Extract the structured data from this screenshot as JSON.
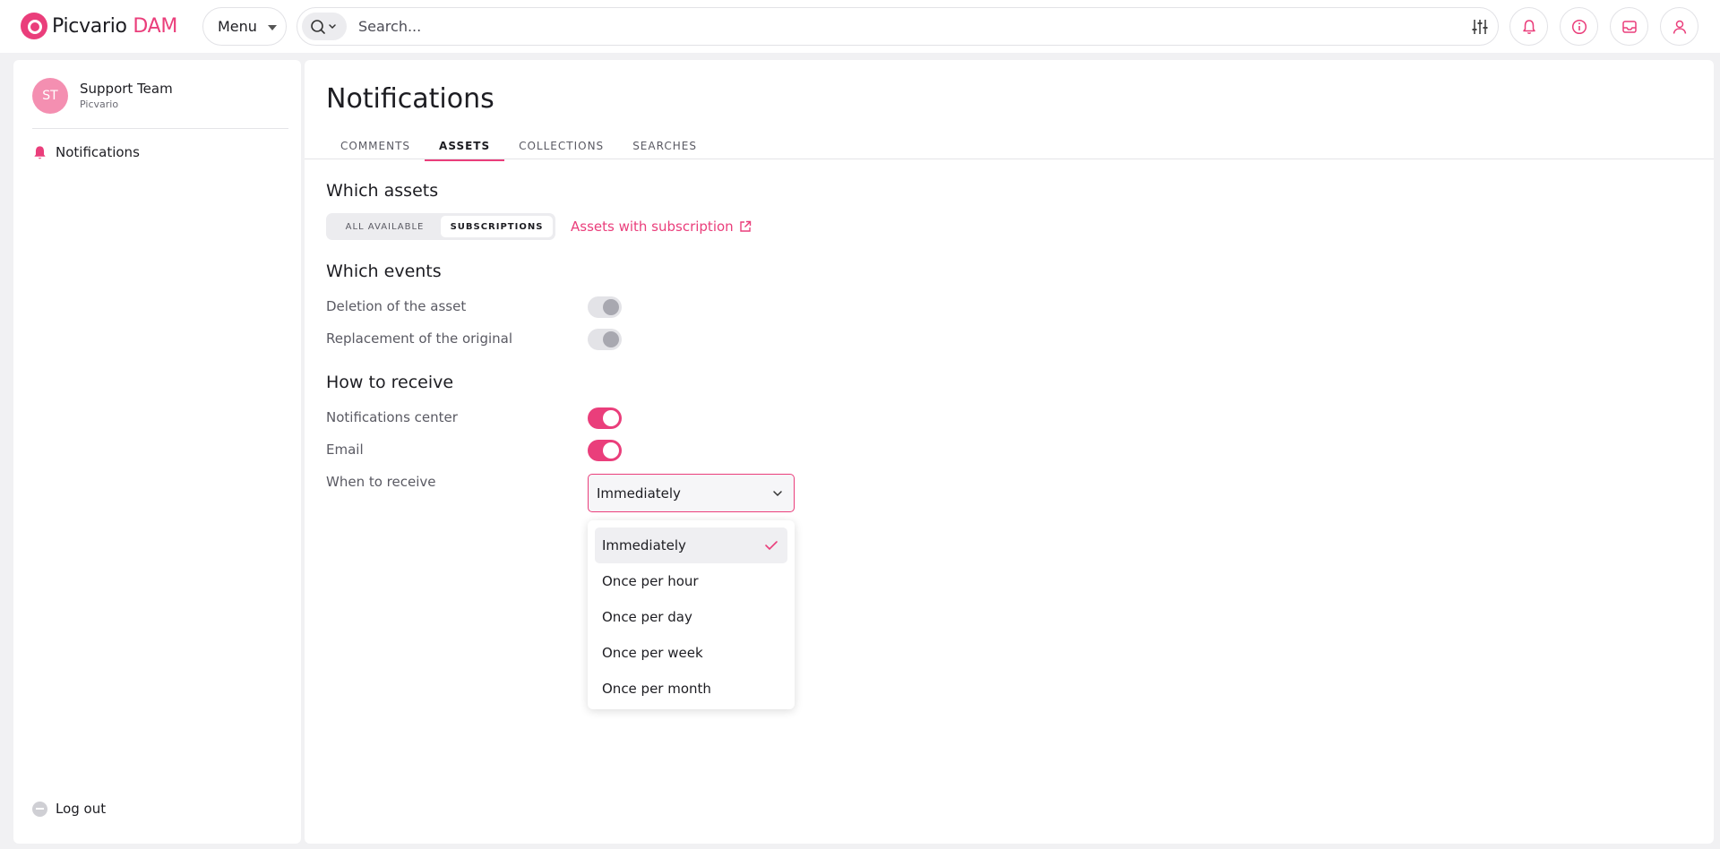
{
  "colors": {
    "accent": "#ea3e7b",
    "background": "#f1f1f3",
    "panel": "#ffffff"
  },
  "topbar": {
    "logo": {
      "name": "Picvario",
      "suffix": "DAM"
    },
    "menu_label": "Menu",
    "search": {
      "placeholder": "Search...",
      "value": ""
    },
    "icons": [
      "search-icon",
      "filter-sliders-icon",
      "bell-icon",
      "info-icon",
      "inbox-icon",
      "user-icon"
    ]
  },
  "sidebar": {
    "user": {
      "initials": "ST",
      "name": "Support Team",
      "org": "Picvario"
    },
    "items": [
      {
        "label": "Notifications",
        "icon": "bell-icon",
        "active": true
      }
    ],
    "logout_label": "Log out"
  },
  "main": {
    "title": "Notifications",
    "tabs": [
      {
        "label": "COMMENTS",
        "active": false
      },
      {
        "label": "ASSETS",
        "active": true
      },
      {
        "label": "COLLECTIONS",
        "active": false
      },
      {
        "label": "SEARCHES",
        "active": false
      }
    ],
    "which_assets": {
      "heading": "Which assets",
      "options": [
        {
          "label": "ALL AVAILABLE",
          "active": false
        },
        {
          "label": "SUBSCRIPTIONS",
          "active": true
        }
      ],
      "link_label": "Assets with subscription"
    },
    "which_events": {
      "heading": "Which events",
      "rows": [
        {
          "label": "Deletion of the asset",
          "on": false
        },
        {
          "label": "Replacement of the original",
          "on": false
        }
      ]
    },
    "how_to_receive": {
      "heading": "How to receive",
      "rows": [
        {
          "label": "Notifications center",
          "on": true
        },
        {
          "label": "Email",
          "on": true
        }
      ],
      "when_label": "When to receive",
      "when_value": "Immediately",
      "options": [
        "Immediately",
        "Once per hour",
        "Once per day",
        "Once per week",
        "Once per month"
      ],
      "selected_option": "Immediately"
    }
  }
}
